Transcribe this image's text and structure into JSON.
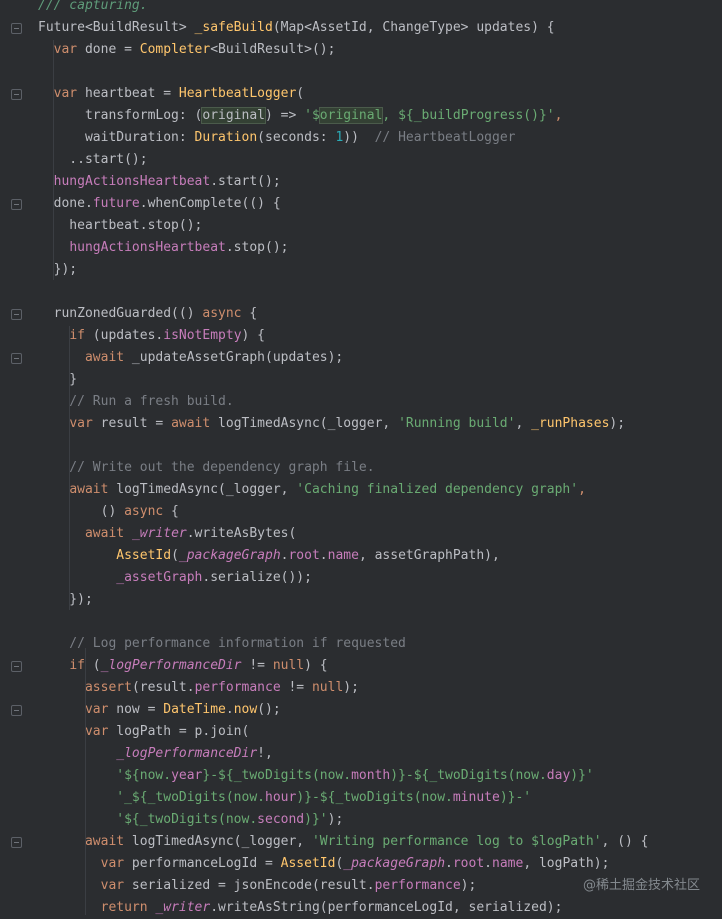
{
  "editor": {
    "watermark": "@稀土掘金技术社区",
    "lines": [
      [
        {
          "t": "/// capturing.",
          "c": "doc"
        }
      ],
      [
        {
          "t": "Future<BuildResult> ",
          "c": "type"
        },
        {
          "t": "_safeBuild",
          "c": "class"
        },
        {
          "t": "(Map<AssetId, ChangeType> updates) {",
          "c": "type"
        }
      ],
      [
        {
          "t": "  ",
          "c": "type"
        },
        {
          "t": "var",
          "c": "kw"
        },
        {
          "t": " done = ",
          "c": "type"
        },
        {
          "t": "Completer",
          "c": "class"
        },
        {
          "t": "<BuildResult>();",
          "c": "type"
        }
      ],
      [],
      [
        {
          "t": "  ",
          "c": "type"
        },
        {
          "t": "var",
          "c": "kw"
        },
        {
          "t": " heartbeat = ",
          "c": "type"
        },
        {
          "t": "HeartbeatLogger",
          "c": "class"
        },
        {
          "t": "(",
          "c": "type"
        }
      ],
      [
        {
          "t": "      transformLog: (",
          "c": "type"
        },
        {
          "t": "original",
          "c": "param",
          "h": true
        },
        {
          "t": ") => ",
          "c": "type"
        },
        {
          "t": "'$",
          "c": "str"
        },
        {
          "t": "original",
          "c": "str",
          "h": true
        },
        {
          "t": ", ${_buildProgress()}'",
          "c": "str"
        },
        {
          "t": ",",
          "c": "kw"
        }
      ],
      [
        {
          "t": "      waitDuration: ",
          "c": "type"
        },
        {
          "t": "Duration",
          "c": "class"
        },
        {
          "t": "(seconds: ",
          "c": "type"
        },
        {
          "t": "1",
          "c": "num"
        },
        {
          "t": "))  ",
          "c": "type"
        },
        {
          "t": "// HeartbeatLogger",
          "c": "comment"
        }
      ],
      [
        {
          "t": "    ..start();",
          "c": "type"
        }
      ],
      [
        {
          "t": "  ",
          "c": "type"
        },
        {
          "t": "hungActionsHeartbeat",
          "c": "field"
        },
        {
          "t": ".start();",
          "c": "type"
        }
      ],
      [
        {
          "t": "  done.",
          "c": "type"
        },
        {
          "t": "future",
          "c": "field"
        },
        {
          "t": ".whenComplete(() {",
          "c": "type"
        }
      ],
      [
        {
          "t": "    heartbeat.stop();",
          "c": "type"
        }
      ],
      [
        {
          "t": "    ",
          "c": "type"
        },
        {
          "t": "hungActionsHeartbeat",
          "c": "field"
        },
        {
          "t": ".stop();",
          "c": "type"
        }
      ],
      [
        {
          "t": "  });",
          "c": "type"
        }
      ],
      [],
      [
        {
          "t": "  runZonedGuarded(() ",
          "c": "type"
        },
        {
          "t": "async",
          "c": "kw"
        },
        {
          "t": " {",
          "c": "type"
        }
      ],
      [
        {
          "t": "    ",
          "c": "type"
        },
        {
          "t": "if",
          "c": "kw"
        },
        {
          "t": " (updates.",
          "c": "type"
        },
        {
          "t": "isNotEmpty",
          "c": "field"
        },
        {
          "t": ") {",
          "c": "type"
        }
      ],
      [
        {
          "t": "      ",
          "c": "type"
        },
        {
          "t": "await",
          "c": "kw"
        },
        {
          "t": " _updateAssetGraph(updates);",
          "c": "type"
        }
      ],
      [
        {
          "t": "    }",
          "c": "type"
        }
      ],
      [
        {
          "t": "    // Run a fresh build.",
          "c": "comment"
        }
      ],
      [
        {
          "t": "    ",
          "c": "type"
        },
        {
          "t": "var",
          "c": "kw"
        },
        {
          "t": " result = ",
          "c": "type"
        },
        {
          "t": "await",
          "c": "kw"
        },
        {
          "t": " logTimedAsync(_logger, ",
          "c": "type"
        },
        {
          "t": "'Running build'",
          "c": "str"
        },
        {
          "t": ", ",
          "c": "type"
        },
        {
          "t": "_runPhases",
          "c": "class"
        },
        {
          "t": ");",
          "c": "type"
        }
      ],
      [],
      [
        {
          "t": "    // Write out the dependency graph file.",
          "c": "comment"
        }
      ],
      [
        {
          "t": "    ",
          "c": "type"
        },
        {
          "t": "await",
          "c": "kw"
        },
        {
          "t": " logTimedAsync(_logger, ",
          "c": "type"
        },
        {
          "t": "'Caching finalized dependency graph'",
          "c": "str"
        },
        {
          "t": ",",
          "c": "kw"
        }
      ],
      [
        {
          "t": "        () ",
          "c": "type"
        },
        {
          "t": "async",
          "c": "kw"
        },
        {
          "t": " {",
          "c": "type"
        }
      ],
      [
        {
          "t": "      ",
          "c": "type"
        },
        {
          "t": "await",
          "c": "kw"
        },
        {
          "t": " ",
          "c": "type"
        },
        {
          "t": "_writer",
          "c": "field",
          "i": true
        },
        {
          "t": ".writeAsBytes(",
          "c": "type"
        }
      ],
      [
        {
          "t": "          ",
          "c": "type"
        },
        {
          "t": "AssetId",
          "c": "class"
        },
        {
          "t": "(",
          "c": "type"
        },
        {
          "t": "_packageGraph",
          "c": "field",
          "i": true
        },
        {
          "t": ".",
          "c": "type"
        },
        {
          "t": "root",
          "c": "field"
        },
        {
          "t": ".",
          "c": "type"
        },
        {
          "t": "name",
          "c": "field"
        },
        {
          "t": ", assetGraphPath),",
          "c": "type"
        }
      ],
      [
        {
          "t": "          ",
          "c": "type"
        },
        {
          "t": "_assetGraph",
          "c": "field"
        },
        {
          "t": ".serialize());",
          "c": "type"
        }
      ],
      [
        {
          "t": "    });",
          "c": "type"
        }
      ],
      [],
      [
        {
          "t": "    // Log performance information if requested",
          "c": "comment"
        }
      ],
      [
        {
          "t": "    ",
          "c": "type"
        },
        {
          "t": "if",
          "c": "kw"
        },
        {
          "t": " (",
          "c": "type"
        },
        {
          "t": "_logPerformanceDir",
          "c": "field",
          "i": true
        },
        {
          "t": " != ",
          "c": "type"
        },
        {
          "t": "null",
          "c": "kw"
        },
        {
          "t": ") {",
          "c": "type"
        }
      ],
      [
        {
          "t": "      ",
          "c": "type"
        },
        {
          "t": "assert",
          "c": "kw"
        },
        {
          "t": "(result.",
          "c": "type"
        },
        {
          "t": "performance",
          "c": "field"
        },
        {
          "t": " != ",
          "c": "type"
        },
        {
          "t": "null",
          "c": "kw"
        },
        {
          "t": ");",
          "c": "type"
        }
      ],
      [
        {
          "t": "      ",
          "c": "type"
        },
        {
          "t": "var",
          "c": "kw"
        },
        {
          "t": " now = ",
          "c": "type"
        },
        {
          "t": "DateTime",
          "c": "class"
        },
        {
          "t": ".",
          "c": "type"
        },
        {
          "t": "now",
          "c": "class"
        },
        {
          "t": "();",
          "c": "type"
        }
      ],
      [
        {
          "t": "      ",
          "c": "type"
        },
        {
          "t": "var",
          "c": "kw"
        },
        {
          "t": " logPath = p.join(",
          "c": "type"
        }
      ],
      [
        {
          "t": "          ",
          "c": "type"
        },
        {
          "t": "_logPerformanceDir",
          "c": "field",
          "i": true
        },
        {
          "t": "!,",
          "c": "type"
        }
      ],
      [
        {
          "t": "          ",
          "c": "type"
        },
        {
          "t": "'${now.",
          "c": "str"
        },
        {
          "t": "year",
          "c": "field"
        },
        {
          "t": "}-${_twoDigits(now.",
          "c": "str"
        },
        {
          "t": "month",
          "c": "field"
        },
        {
          "t": ")}-${_twoDigits(now.",
          "c": "str"
        },
        {
          "t": "day",
          "c": "field"
        },
        {
          "t": ")}'",
          "c": "str"
        }
      ],
      [
        {
          "t": "          ",
          "c": "type"
        },
        {
          "t": "'_${_twoDigits(now.",
          "c": "str"
        },
        {
          "t": "hour",
          "c": "field"
        },
        {
          "t": ")}-${_twoDigits(now.",
          "c": "str"
        },
        {
          "t": "minute",
          "c": "field"
        },
        {
          "t": ")}-'",
          "c": "str"
        }
      ],
      [
        {
          "t": "          ",
          "c": "type"
        },
        {
          "t": "'${_twoDigits(now.",
          "c": "str"
        },
        {
          "t": "second",
          "c": "field"
        },
        {
          "t": ")}'",
          "c": "str"
        },
        {
          "t": ");",
          "c": "type"
        }
      ],
      [
        {
          "t": "      ",
          "c": "type"
        },
        {
          "t": "await",
          "c": "kw"
        },
        {
          "t": " logTimedAsync(_logger, ",
          "c": "type"
        },
        {
          "t": "'Writing performance log to $logPath'",
          "c": "str"
        },
        {
          "t": ", () {",
          "c": "type"
        }
      ],
      [
        {
          "t": "        ",
          "c": "type"
        },
        {
          "t": "var",
          "c": "kw"
        },
        {
          "t": " performanceLogId = ",
          "c": "type"
        },
        {
          "t": "AssetId",
          "c": "class"
        },
        {
          "t": "(",
          "c": "type"
        },
        {
          "t": "_packageGraph",
          "c": "field",
          "i": true
        },
        {
          "t": ".",
          "c": "type"
        },
        {
          "t": "root",
          "c": "field"
        },
        {
          "t": ".",
          "c": "type"
        },
        {
          "t": "name",
          "c": "field"
        },
        {
          "t": ", logPath);",
          "c": "type"
        }
      ],
      [
        {
          "t": "        ",
          "c": "type"
        },
        {
          "t": "var",
          "c": "kw"
        },
        {
          "t": " serialized = jsonEncode(result.",
          "c": "type"
        },
        {
          "t": "performance",
          "c": "field"
        },
        {
          "t": ");",
          "c": "type"
        }
      ],
      [
        {
          "t": "        ",
          "c": "type"
        },
        {
          "t": "return",
          "c": "kw"
        },
        {
          "t": " ",
          "c": "type"
        },
        {
          "t": "_writer",
          "c": "field",
          "i": true
        },
        {
          "t": ".writeAsString(performanceLogId, serialized);",
          "c": "type"
        }
      ]
    ]
  }
}
